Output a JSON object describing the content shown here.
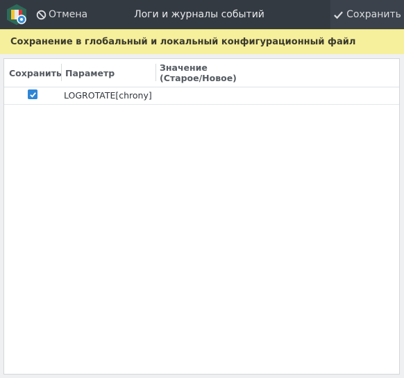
{
  "window": {
    "title": "Логи и журналы событий",
    "cancel_label": "Отмена",
    "save_label": "Сохранить"
  },
  "banner": {
    "text": "Сохранение в глобальный и локальный конфигурационный файл"
  },
  "table": {
    "columns": [
      "Сохранить",
      "Параметр",
      "Значение\n(Старое/Новое)"
    ],
    "rows": [
      {
        "checked": true,
        "parameter": "LOGROTATE[chrony]",
        "value": ""
      }
    ]
  },
  "colors": {
    "titlebar": "#343a42",
    "banner": "#f6ef9c",
    "checkbox": "#2f86d6"
  }
}
